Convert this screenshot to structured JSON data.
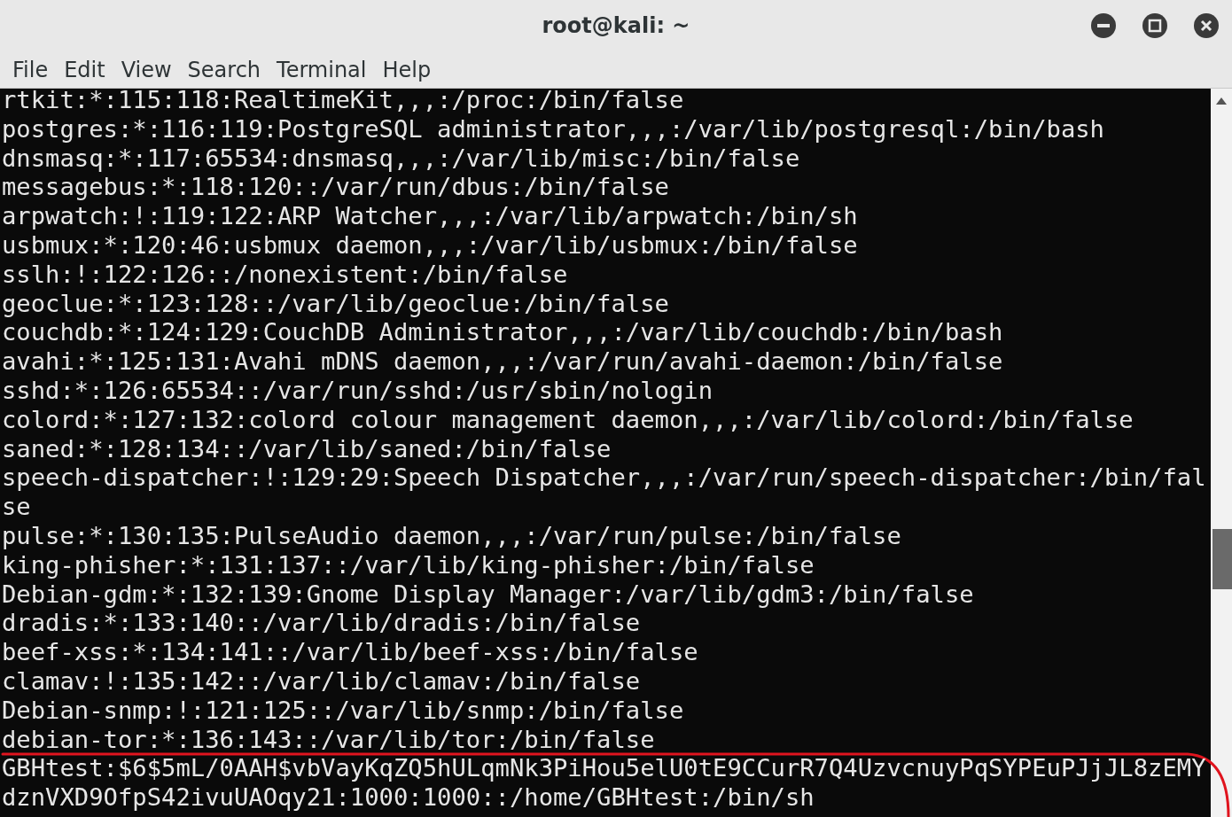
{
  "window": {
    "title": "root@kali: ~"
  },
  "menu": [
    "File",
    "Edit",
    "View",
    "Search",
    "Terminal",
    "Help"
  ],
  "terminal": {
    "lines": [
      "rtkit:*:115:118:RealtimeKit,,,:/proc:/bin/false",
      "postgres:*:116:119:PostgreSQL administrator,,,:/var/lib/postgresql:/bin/bash",
      "dnsmasq:*:117:65534:dnsmasq,,,:/var/lib/misc:/bin/false",
      "messagebus:*:118:120::/var/run/dbus:/bin/false",
      "arpwatch:!:119:122:ARP Watcher,,,:/var/lib/arpwatch:/bin/sh",
      "usbmux:*:120:46:usbmux daemon,,,:/var/lib/usbmux:/bin/false",
      "sslh:!:122:126::/nonexistent:/bin/false",
      "geoclue:*:123:128::/var/lib/geoclue:/bin/false",
      "couchdb:*:124:129:CouchDB Administrator,,,:/var/lib/couchdb:/bin/bash",
      "avahi:*:125:131:Avahi mDNS daemon,,,:/var/run/avahi-daemon:/bin/false",
      "sshd:*:126:65534::/var/run/sshd:/usr/sbin/nologin",
      "colord:*:127:132:colord colour management daemon,,,:/var/lib/colord:/bin/false",
      "saned:*:128:134::/var/lib/saned:/bin/false",
      "speech-dispatcher:!:129:29:Speech Dispatcher,,,:/var/run/speech-dispatcher:/bin/fal",
      "se",
      "pulse:*:130:135:PulseAudio daemon,,,:/var/run/pulse:/bin/false",
      "king-phisher:*:131:137::/var/lib/king-phisher:/bin/false",
      "Debian-gdm:*:132:139:Gnome Display Manager:/var/lib/gdm3:/bin/false",
      "dradis:*:133:140::/var/lib/dradis:/bin/false",
      "beef-xss:*:134:141::/var/lib/beef-xss:/bin/false",
      "clamav:!:135:142::/var/lib/clamav:/bin/false",
      "Debian-snmp:!:121:125::/var/lib/snmp:/bin/false",
      "debian-tor:*:136:143::/var/lib/tor:/bin/false",
      "GBHtest:$6$5mL/0AAH$vbVayKqZQ5hULqmNk3PiHou5elU0tE9CCurR7Q4UzvcnuyPqSYPEuPJjJL8zEMY",
      "dznVXD9OfpS42ivuUAOqy21:1000:1000::/home/GBHtest:/bin/sh"
    ]
  }
}
